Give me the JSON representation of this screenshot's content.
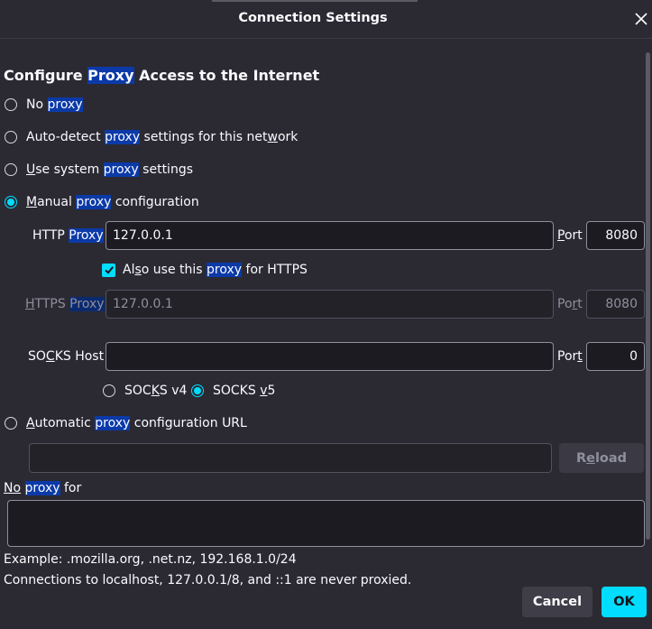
{
  "window": {
    "title": "Connection Settings"
  },
  "heading": {
    "pre": "Configure ",
    "hl": "Proxy",
    "post": " Access to the Internet"
  },
  "options": {
    "no_proxy": {
      "a": "No ",
      "hl": "proxy"
    },
    "auto_detect": {
      "a": "Auto-detect ",
      "hl": "proxy",
      "b": " settings for this net",
      "u": "w",
      "c": "ork"
    },
    "system": {
      "u": "U",
      "a": "se system ",
      "hl": "proxy",
      "b": " settings"
    },
    "manual": {
      "u": "M",
      "a": "anual ",
      "hl": "proxy",
      "b": " configuration",
      "checked": true
    },
    "auto_url": {
      "u": "A",
      "a": "utomatic ",
      "hl": "proxy",
      "b": " configuration URL"
    }
  },
  "http": {
    "label_a": "HTTP ",
    "label_hl": "Proxy",
    "value": "127.0.0.1",
    "port_u": "P",
    "port_rest": "ort",
    "port": "8080"
  },
  "https_also": {
    "a": "Al",
    "u": "s",
    "b": "o use this ",
    "hl": "proxy",
    "c": " for HTTPS",
    "checked": true
  },
  "https": {
    "label_u": "H",
    "label_a": "TTPS ",
    "label_hl": "Proxy",
    "value": "127.0.0.1",
    "port_a": "Po",
    "port_u": "r",
    "port_b": "t",
    "port": "8080"
  },
  "socks": {
    "label_a": "SO",
    "label_u": "C",
    "label_b": "KS Host",
    "value": "",
    "port_a": "Por",
    "port_u": "t",
    "port": "0",
    "v4_a": "SOC",
    "v4_u": "K",
    "v4_b": "S v4",
    "v5_a": "SOCKS ",
    "v5_u": "v",
    "v5_b": "5",
    "selected": "v5"
  },
  "reload": {
    "a": "R",
    "u": "e",
    "b": "load"
  },
  "no_proxy_for": {
    "u": "No",
    "sp": " ",
    "hl": "proxy",
    "b": " for"
  },
  "example": "Example: .mozilla.org, .net.nz, 192.168.1.0/24",
  "localhost_note": "Connections to localhost, 127.0.0.1/8, and ::1 are never proxied.",
  "buttons": {
    "cancel": "Cancel",
    "ok": "OK"
  },
  "colors": {
    "accent": "#00ddff",
    "highlight": "#0b3aa8",
    "background": "#2b2a33"
  }
}
